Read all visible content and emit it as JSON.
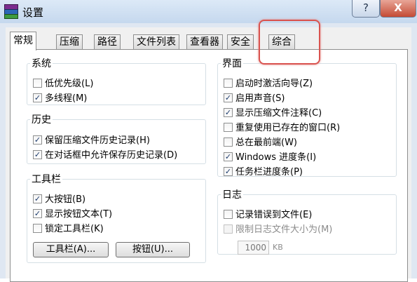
{
  "window": {
    "title": "设置",
    "help_label": "?",
    "close_label": "X"
  },
  "tabs": [
    "常规",
    "压缩",
    "路径",
    "文件列表",
    "查看器",
    "安全",
    "综合"
  ],
  "groups": {
    "system": {
      "title": "系统",
      "items": [
        {
          "label": "低优先级(L)",
          "checked": false
        },
        {
          "label": "多线程(M)",
          "checked": true
        }
      ]
    },
    "history": {
      "title": "历史",
      "items": [
        {
          "label": "保留压缩文件历史记录(H)",
          "checked": true
        },
        {
          "label": "在对话框中允许保存历史记录(D)",
          "checked": true
        }
      ]
    },
    "toolbar": {
      "title": "工具栏",
      "items": [
        {
          "label": "大按钮(B)",
          "checked": true
        },
        {
          "label": "显示按钮文本(T)",
          "checked": true
        },
        {
          "label": "锁定工具栏(K)",
          "checked": false
        }
      ],
      "toolbar_button": "工具栏(A)...",
      "buttons_button": "按钮(U)..."
    },
    "interface": {
      "title": "界面",
      "items": [
        {
          "label": "启动时激活向导(Z)",
          "checked": false
        },
        {
          "label": "启用声音(S)",
          "checked": true
        },
        {
          "label": "显示压缩文件注释(C)",
          "checked": true
        },
        {
          "label": "重复使用已存在的窗口(R)",
          "checked": false
        },
        {
          "label": "总在最前端(W)",
          "checked": false
        },
        {
          "label": "Windows 进度条(I)",
          "checked": true
        },
        {
          "label": "任务栏进度条(P)",
          "checked": true
        }
      ]
    },
    "log": {
      "title": "日志",
      "items": [
        {
          "label": "记录错误到文件(E)",
          "checked": false,
          "disabled": false
        },
        {
          "label": "限制日志文件大小为(M)",
          "checked": false,
          "disabled": true
        }
      ],
      "size_value": "1000",
      "size_unit": "KB"
    }
  },
  "colors": {
    "highlight": "#d9534f"
  }
}
